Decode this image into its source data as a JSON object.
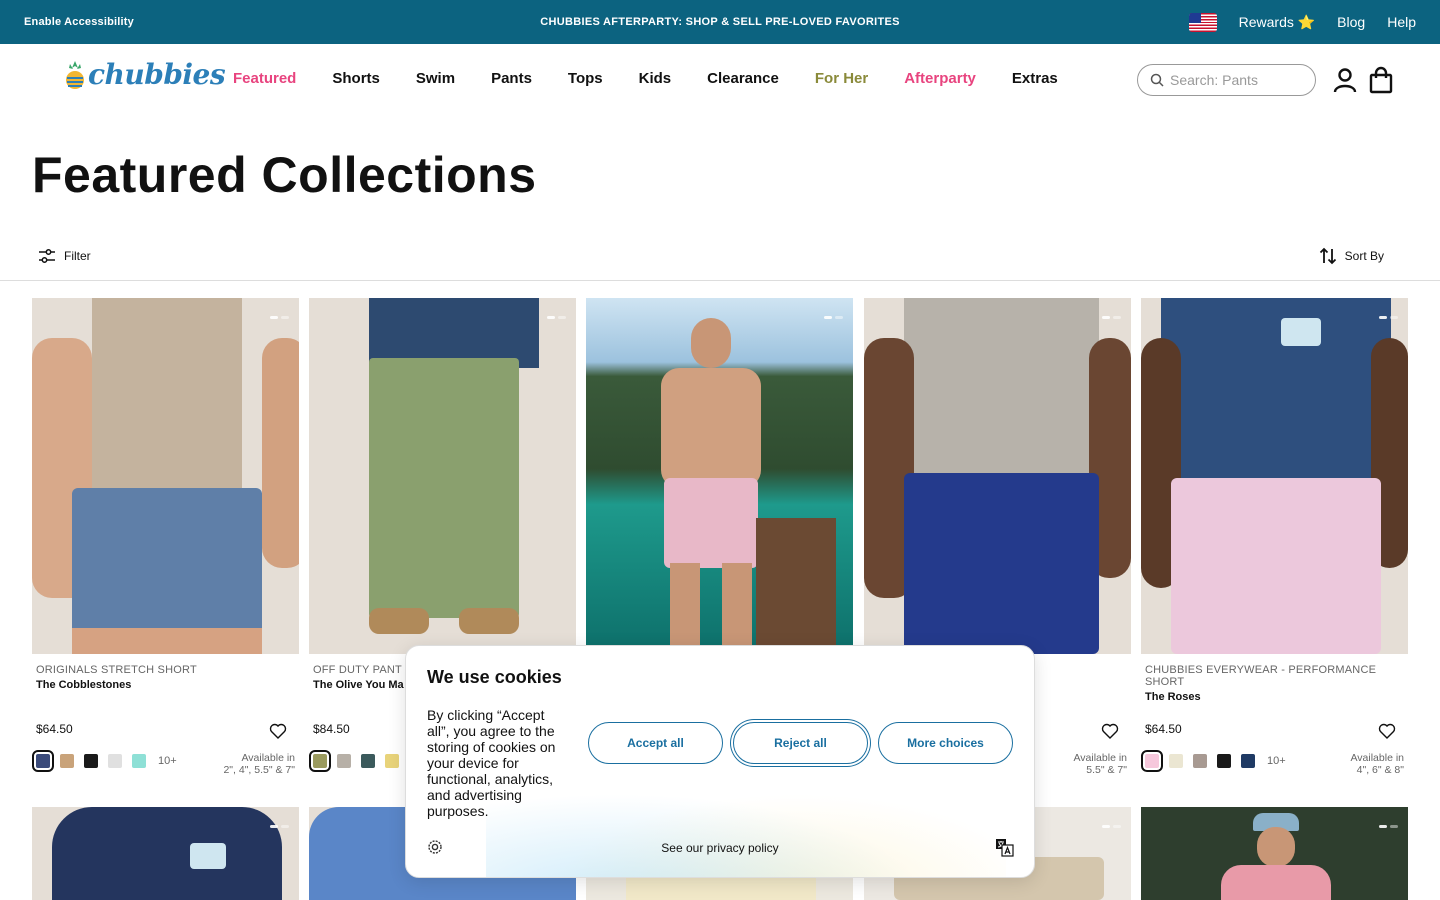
{
  "topbar": {
    "accessibility": "Enable Accessibility",
    "promo": "CHUBBIES AFTERPARTY: SHOP & SELL PRE-LOVED FAVORITES",
    "rewards": "Rewards ⭐",
    "blog": "Blog",
    "help": "Help"
  },
  "nav": {
    "logo": "chubbies",
    "links": [
      "Featured",
      "Shorts",
      "Swim",
      "Pants",
      "Tops",
      "Kids",
      "Clearance",
      "For Her",
      "Afterparty",
      "Extras"
    ],
    "search_placeholder": "Search: Pants"
  },
  "page": {
    "title": "Featured Collections",
    "filter": "Filter",
    "sort": "Sort By"
  },
  "products": [
    {
      "collection": "ORIGINALS STRETCH SHORT",
      "name": "The Cobblestones",
      "price": "$64.50",
      "swatches": [
        "#3a4a7a",
        "#c9a37a",
        "#1a1a1a",
        "#e0e0e0",
        "#8ee0d6"
      ],
      "more": "10+",
      "avail_line1": "Available in",
      "avail_line2": "2\", 4\", 5.5\" & 7\""
    },
    {
      "collection": "OFF DUTY PANT",
      "name": "The Olive You Ma",
      "price": "$84.50",
      "swatches": [
        "#9a9a5e",
        "#b7b0a7",
        "#3b5a5c",
        "#e8d37a"
      ],
      "more": "",
      "avail_line1": "",
      "avail_line2": ""
    },
    {
      "collection": "",
      "name": "",
      "price": "",
      "swatches": [],
      "more": "",
      "avail_line1": "",
      "avail_line2": ""
    },
    {
      "collection": "",
      "name": "",
      "price": "",
      "swatches": [],
      "more": "",
      "avail_line1": "Available in",
      "avail_line2": "5.5\" & 7\""
    },
    {
      "collection": "CHUBBIES EVERYWEAR - PERFORMANCE SHORT",
      "name": "The Roses",
      "price": "$64.50",
      "swatches": [
        "#f6c8dc",
        "#ebe6d2",
        "#a89a92",
        "#1a1a1a",
        "#1f3a64"
      ],
      "more": "10+",
      "avail_line1": "Available in",
      "avail_line2": "4\", 6\" & 8\""
    }
  ],
  "cookie": {
    "title": "We use cookies",
    "body": "By clicking “Accept all”, you agree to the storing of cookies on your device for functional, analytics, and advertising purposes.",
    "accept": "Accept all",
    "reject": "Reject all",
    "more": "More choices",
    "policy": "See our privacy policy"
  },
  "colors": {
    "topbar": "#0c6380",
    "accent_pink": "#e8447f",
    "accent_olive": "#8a8a3a",
    "cookie_button": "#1a6fa0"
  }
}
